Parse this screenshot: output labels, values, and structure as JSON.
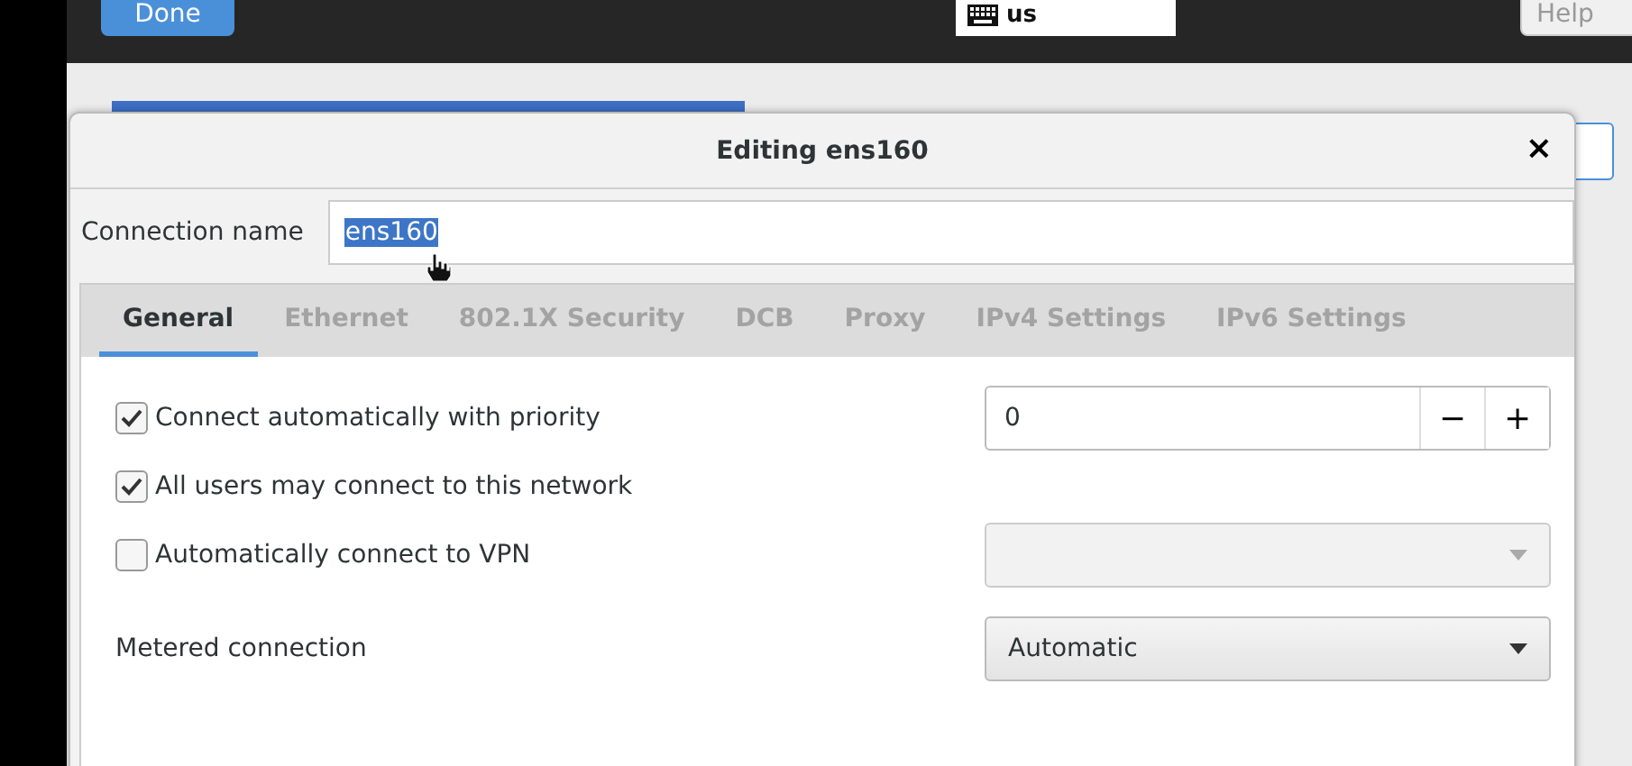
{
  "top_bar": {
    "done_button": "Done",
    "keyboard_layout": "us",
    "help_button": "Help"
  },
  "dialog": {
    "title": "Editing ens160",
    "close": "×",
    "connection_name": {
      "label": "Connection name",
      "value": "ens160",
      "text_selected": true
    },
    "tabs": [
      {
        "label": "General",
        "selected": true
      },
      {
        "label": "Ethernet",
        "selected": false
      },
      {
        "label": "802.1X Security",
        "selected": false
      },
      {
        "label": "DCB",
        "selected": false
      },
      {
        "label": "Proxy",
        "selected": false
      },
      {
        "label": "IPv4 Settings",
        "selected": false
      },
      {
        "label": "IPv6 Settings",
        "selected": false
      }
    ],
    "options": [
      {
        "label": "Connect automatically with priority",
        "checked": true,
        "kind": "spin",
        "value": "0",
        "decrement": "−",
        "increment": "+"
      },
      {
        "label": "All users may connect to this network",
        "checked": true,
        "kind": "plain"
      },
      {
        "label": "Automatically connect to VPN",
        "checked": false,
        "kind": "combo",
        "disabled": true
      }
    ],
    "metered": {
      "label": "Metered connection",
      "value": "Automatic"
    }
  }
}
